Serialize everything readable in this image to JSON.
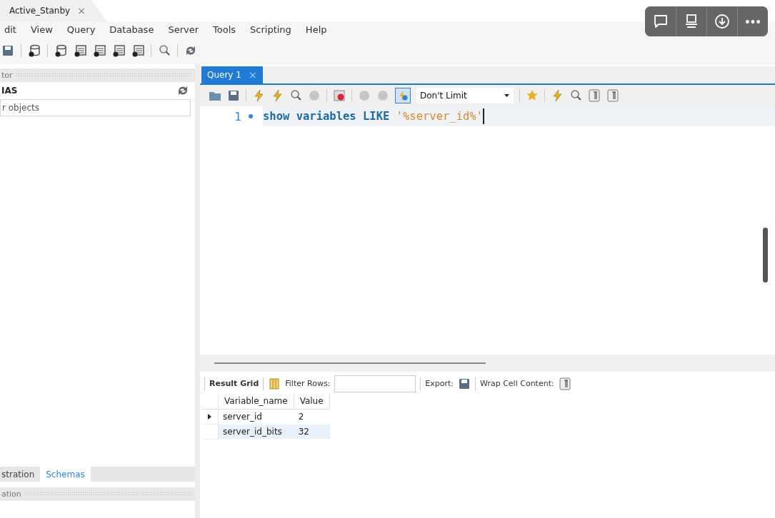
{
  "document_tab": {
    "label": "Active_Stanby",
    "close": "×"
  },
  "menu": [
    "dit",
    "View",
    "Query",
    "Database",
    "Server",
    "Tools",
    "Scripting",
    "Help"
  ],
  "navigator": {
    "header": "tor",
    "section": "IAS",
    "filter_placeholder": "r objects",
    "info_header": "ation",
    "tabs": [
      {
        "label": "stration",
        "selected": false
      },
      {
        "label": "Schemas",
        "selected": true
      }
    ]
  },
  "query_tab": {
    "label": "Query 1",
    "close": "×",
    "selected": true
  },
  "query_toolbar": {
    "toggle_on": true,
    "limit": "Don't Limit"
  },
  "editor": {
    "line_number": "1",
    "tokens": [
      {
        "kind": "keyword",
        "text": "show "
      },
      {
        "kind": "keyword",
        "text": "variables "
      },
      {
        "kind": "keyword",
        "text": "LIKE "
      },
      {
        "kind": "string",
        "text": "'%server_id%'"
      }
    ]
  },
  "results": {
    "title": "Result Grid",
    "filter_label": "Filter Rows:",
    "export_label": "Export:",
    "wrap_label": "Wrap Cell Content:",
    "columns": [
      "Variable_name",
      "Value"
    ],
    "rows": [
      {
        "cells": [
          "server_id",
          "2"
        ],
        "current": true
      },
      {
        "cells": [
          "server_id_bits",
          "32"
        ],
        "current": false
      }
    ]
  }
}
